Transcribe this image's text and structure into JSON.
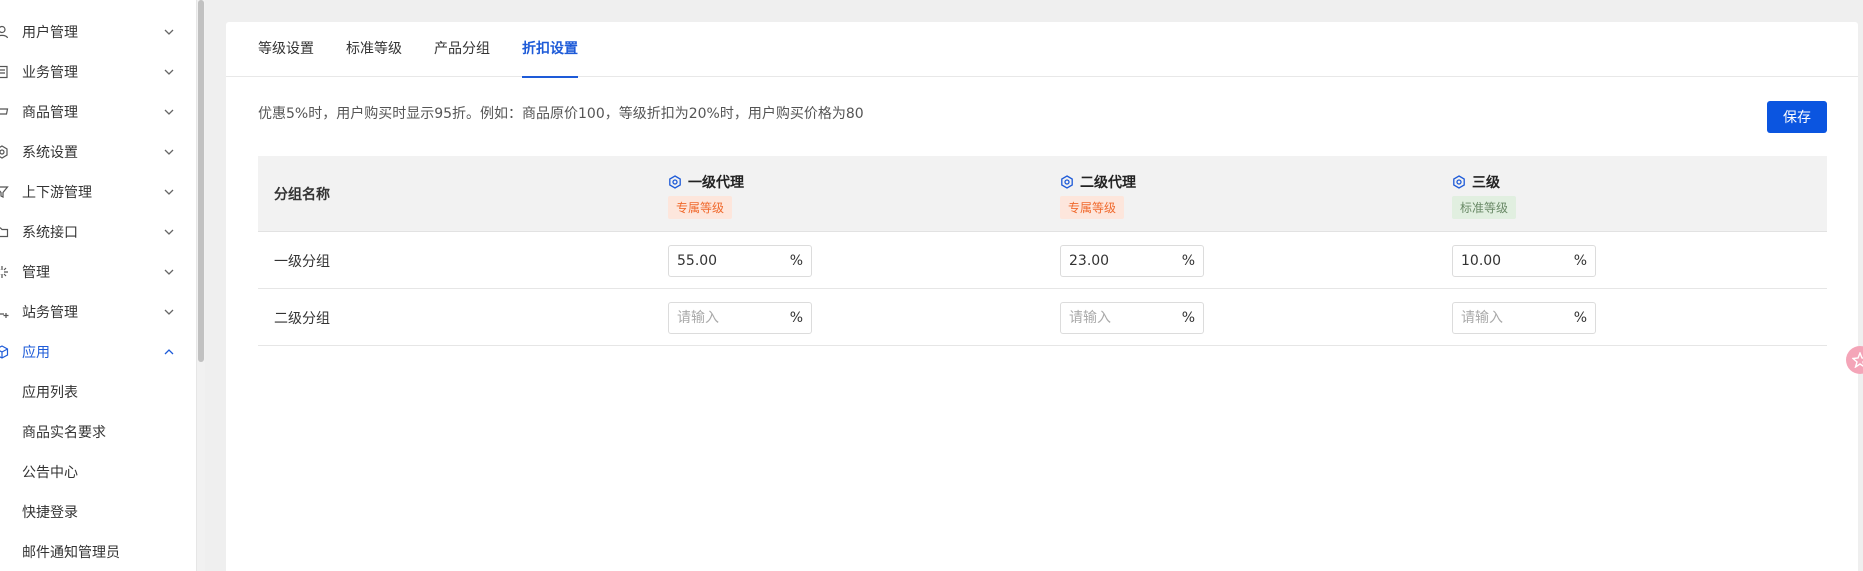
{
  "sidebar": {
    "items": [
      {
        "label": "用户管理",
        "icon": "user-icon"
      },
      {
        "label": "业务管理",
        "icon": "document-icon"
      },
      {
        "label": "商品管理",
        "icon": "cart-icon"
      },
      {
        "label": "系统设置",
        "icon": "gear-icon"
      },
      {
        "label": "上下游管理",
        "icon": "filter-icon"
      },
      {
        "label": "系统接口",
        "icon": "folder-icon"
      },
      {
        "label": "管理",
        "icon": "sparkle-icon"
      },
      {
        "label": "站务管理",
        "icon": "cart-add-icon"
      },
      {
        "label": "应用",
        "icon": "cube-icon"
      }
    ],
    "sub_items": [
      "应用列表",
      "商品实名要求",
      "公告中心",
      "快捷登录",
      "邮件通知管理员"
    ]
  },
  "tabs": [
    "等级设置",
    "标准等级",
    "产品分组",
    "折扣设置"
  ],
  "active_tab": "折扣设置",
  "hint": "优惠5%时，用户购买时显示95折。例如：商品原价100，等级折扣为20%时，用户购买价格为80",
  "save_label": "保存",
  "table": {
    "first_header": "分组名称",
    "columns": [
      {
        "name": "一级代理",
        "badge": "专属等级"
      },
      {
        "name": "二级代理",
        "badge": "专属等级"
      },
      {
        "name": "三级",
        "badge": "标准等级"
      }
    ],
    "rows": [
      {
        "name": "一级分组",
        "values": [
          "55.00",
          "23.00",
          "10.00"
        ]
      },
      {
        "name": "二级分组",
        "values": [
          "",
          "",
          ""
        ]
      }
    ],
    "placeholder": "请输入",
    "unit": "%"
  },
  "colors": {
    "accent": "#1e5bd8",
    "button": "#0b55e0",
    "exclusive_badge": "#f06a2e",
    "standard_badge": "#6a8a67"
  }
}
